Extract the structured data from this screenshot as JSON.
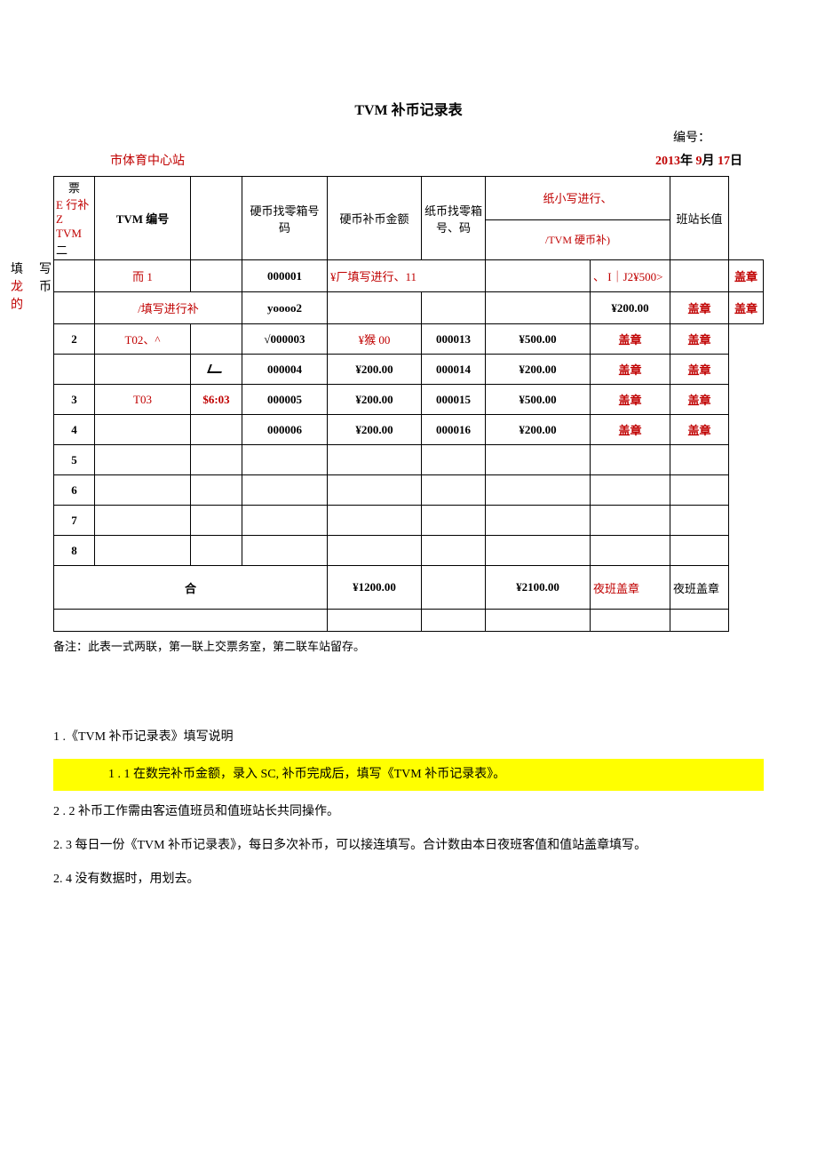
{
  "title": "TVM 补币记录表",
  "doc_num_label": "编号：",
  "station": "市体育中心站",
  "date": {
    "y": "2013",
    "ylabel": "年",
    "m": "9",
    "mlabel": "月",
    "d": "17",
    "dlabel": "日"
  },
  "margin": {
    "a1": "填",
    "a2": "写",
    "a3": "龙",
    "a4": "币",
    "a5": "的"
  },
  "headers": {
    "c0a": "票",
    "c0b": "E 行补 Z",
    "c0c": "TVM",
    "c0d": "二",
    "c1": "TVM 编号",
    "c2": "",
    "c3": "硬币找零箱号码",
    "c4": "硬币补币金额",
    "c5a": "纸币找零箱号、码",
    "c6a": "纸小写进行、",
    "c6b": "/TVM 硬币补)",
    "c7": "",
    "c8": "班站长值"
  },
  "rows": [
    {
      "n": "",
      "tvm": "而 1",
      "tvm_red": true,
      "t": "",
      "box": "000001",
      "box_bold": true,
      "coin": "¥厂填写进行、11",
      "coin_red": true,
      "pbox": "",
      "paper": "、\nI｜J2¥500>",
      "paper_red": true,
      "s1": "",
      "s2": "盖章",
      "s2_red": true
    },
    {
      "n": "",
      "tvm": "/填写进行补",
      "tvm_red": true,
      "tvm_span2": true,
      "t": "",
      "box": "yoooo2",
      "box_bold": true,
      "coin": "",
      "pbox": "",
      "paper": "¥200.00",
      "paper_bold": true,
      "s1": "盖章",
      "s1_red": true,
      "s2": "盖章",
      "s2_red": true
    },
    {
      "n": "2",
      "tvm": "T02、^",
      "tvm_red": true,
      "t": "",
      "box": "√000003",
      "box_bold": true,
      "coin": "¥猴 00",
      "coin_red": true,
      "pbox": "000013",
      "pbox_bold": true,
      "paper": "¥500.00",
      "paper_bold": true,
      "s1": "盖章",
      "s1_red": true,
      "s2": "盖章",
      "s2_red": true
    },
    {
      "n": "",
      "tvm": "",
      "t_slash": true,
      "t": "",
      "box": "000004",
      "box_bold": true,
      "coin": "¥200.00",
      "coin_bold": true,
      "pbox": "000014",
      "pbox_bold": true,
      "paper": "¥200.00",
      "paper_bold": true,
      "s1": "盖章",
      "s1_red": true,
      "s2": "盖章",
      "s2_red": true
    },
    {
      "n": "3",
      "tvm": "T03",
      "tvm_red": true,
      "t": "$6:03",
      "t_red": true,
      "box": "000005",
      "box_bold": true,
      "coin": "¥200.00",
      "coin_bold": true,
      "pbox": "000015",
      "pbox_bold": true,
      "paper": "¥500.00",
      "paper_bold": true,
      "s1": "盖章",
      "s1_red": true,
      "s2": "盖章",
      "s2_red": true
    },
    {
      "n": "4",
      "tvm": "",
      "t": "",
      "box": "000006",
      "box_bold": true,
      "coin": "¥200.00",
      "coin_bold": true,
      "pbox": "000016",
      "pbox_bold": true,
      "paper": "¥200.00",
      "paper_bold": true,
      "s1": "盖章",
      "s1_red": true,
      "s2": "盖章",
      "s2_red": true
    },
    {
      "n": "5",
      "tvm": "",
      "t": "",
      "box": "",
      "coin": "",
      "pbox": "",
      "paper": "",
      "s1": "",
      "s2": ""
    },
    {
      "n": "6",
      "tvm": "",
      "t": "",
      "box": "",
      "coin": "",
      "pbox": "",
      "paper": "",
      "s1": "",
      "s2": ""
    },
    {
      "n": "7",
      "tvm": "",
      "t": "",
      "box": "",
      "coin": "",
      "pbox": "",
      "paper": "",
      "s1": "",
      "s2": ""
    },
    {
      "n": "8",
      "tvm": "",
      "t": "",
      "box": "",
      "coin": "",
      "pbox": "",
      "paper": "",
      "s1": "",
      "s2": ""
    }
  ],
  "total": {
    "label": "合",
    "coin": "¥1200.00",
    "paper": "¥2100.00",
    "s1": "夜班盖章",
    "s2": "夜班盖章"
  },
  "footnote": "备注：此表一式两联，第一联上交票务室，第二联车站留存。",
  "instr": {
    "l1": "1  .《TVM 补币记录表》填写说明",
    "l2": "1  . 1 在数完补币金额，录入 SC, 补币完成后，填写《TVM 补币记录表》。",
    "l3": "2  . 2 补币工作需由客运值班员和值班站长共同操作。",
    "l4": "2. 3 每日一份《TVM 补币记录表》，每日多次补币，可以接连填写。合计数由本日夜班客值和值站盖章填写。",
    "l5": "2. 4 没有数据时，用划去。"
  }
}
